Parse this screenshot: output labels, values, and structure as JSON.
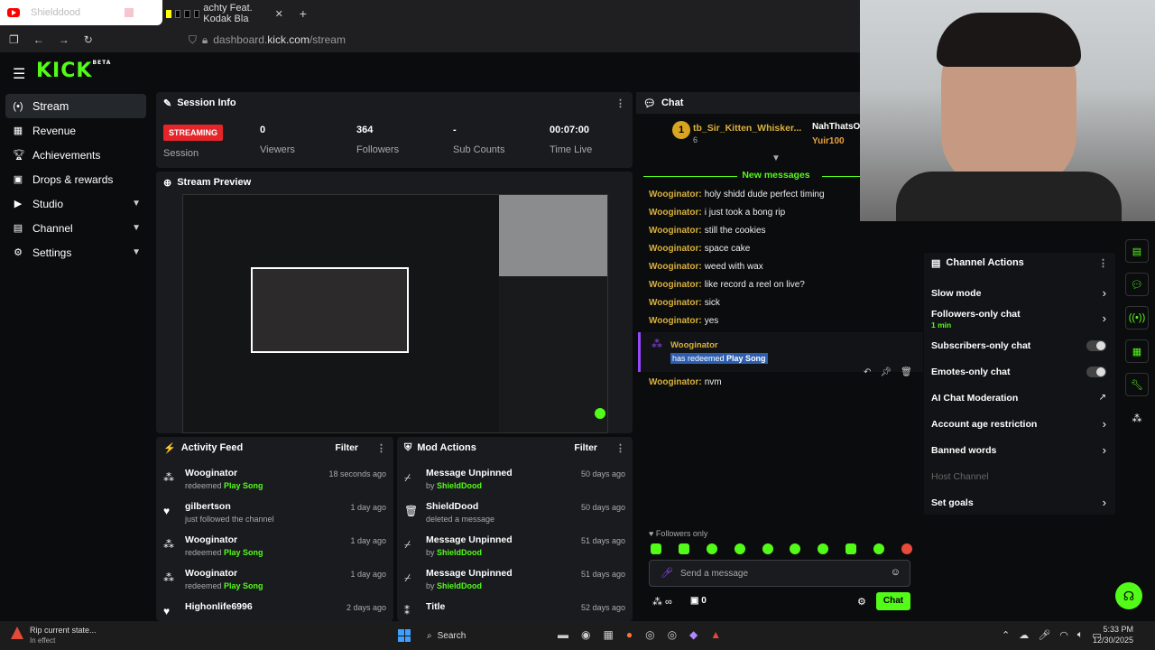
{
  "browser": {
    "tab1_title": "Shielddood",
    "tab2_title": "achty Feat. Kodak Bla",
    "url_prefix": "dashboard.",
    "url_domain": "kick.com",
    "url_path": "/stream"
  },
  "app": {
    "logo": "KICK",
    "logo_badge": "BETA"
  },
  "sidebar": {
    "items": [
      {
        "label": "Stream",
        "icon": "stream-icon"
      },
      {
        "label": "Revenue",
        "icon": "revenue-icon"
      },
      {
        "label": "Achievements",
        "icon": "trophy-icon"
      },
      {
        "label": "Drops & rewards",
        "icon": "gift-icon"
      },
      {
        "label": "Studio",
        "icon": "video-icon"
      },
      {
        "label": "Channel",
        "icon": "channel-icon"
      },
      {
        "label": "Settings",
        "icon": "gear-icon"
      }
    ]
  },
  "session": {
    "title": "Session Info",
    "status": "STREAMING",
    "status_label": "Session",
    "viewers": "0",
    "viewers_label": "Viewers",
    "followers": "364",
    "followers_label": "Followers",
    "subs": "-",
    "subs_label": "Sub Counts",
    "time": "00:07:00",
    "time_label": "Time Live"
  },
  "preview": {
    "title": "Stream Preview"
  },
  "activity": {
    "title": "Activity Feed",
    "filter": "Filter",
    "rows": [
      {
        "name": "Wooginator",
        "pre": "redeemed ",
        "hl": "Play Song",
        "time": "18 seconds ago"
      },
      {
        "name": "gilbertson",
        "pre": "just followed the channel",
        "hl": "",
        "time": "1 day ago"
      },
      {
        "name": "Wooginator",
        "pre": "redeemed ",
        "hl": "Play Song",
        "time": "1 day ago"
      },
      {
        "name": "Wooginator",
        "pre": "redeemed ",
        "hl": "Play Song",
        "time": "1 day ago"
      },
      {
        "name": "Highonlife6996",
        "pre": "",
        "hl": "",
        "time": "2 days ago"
      }
    ]
  },
  "mod": {
    "title": "Mod Actions",
    "filter": "Filter",
    "rows": [
      {
        "name": "Message Unpinned",
        "pre": "by ",
        "hl": "ShieldDood",
        "time": "50 days ago"
      },
      {
        "name": "ShieldDood",
        "pre": "deleted a message",
        "hl": "",
        "time": "50 days ago"
      },
      {
        "name": "Message Unpinned",
        "pre": "by ",
        "hl": "ShieldDood",
        "time": "51 days ago"
      },
      {
        "name": "Message Unpinned",
        "pre": "by ",
        "hl": "ShieldDood",
        "time": "51 days ago"
      },
      {
        "name": "Title",
        "pre": "",
        "hl": "",
        "time": "52 days ago"
      }
    ]
  },
  "chat": {
    "title": "Chat",
    "gifter1": "tb_Sir_Kitten_Whisker...",
    "gifter1_count": "6",
    "gifter2": "NahThatsOk",
    "gifter3": "Yuir100",
    "new_messages": "New messages",
    "messages": [
      {
        "user": "Wooginator:",
        "text": "holy shidd dude perfect timing"
      },
      {
        "user": "Wooginator:",
        "text": "i just took a bong rip"
      },
      {
        "user": "Wooginator:",
        "text": "still the cookies"
      },
      {
        "user": "Wooginator:",
        "text": "space cake"
      },
      {
        "user": "Wooginator:",
        "text": "weed with wax"
      },
      {
        "user": "Wooginator:",
        "text": "like record a reel on live?"
      },
      {
        "user": "Wooginator:",
        "text": "sick"
      },
      {
        "user": "Wooginator:",
        "text": "yes"
      }
    ],
    "redeem_user": "Wooginator",
    "redeem_text": "has redeemed ",
    "redeem_item": "Play Song",
    "last_user": "Wooginator:",
    "last_text": "nvm",
    "followers_only": "Followers only",
    "placeholder": "Send a message",
    "count": "0",
    "send": "Chat"
  },
  "channel_actions": {
    "title": "Channel Actions",
    "items": [
      {
        "label": "Slow mode",
        "kind": "chevron"
      },
      {
        "label": "Followers-only chat",
        "sub": "1 min",
        "kind": "chevron"
      },
      {
        "label": "Subscribers-only chat",
        "kind": "toggle"
      },
      {
        "label": "Emotes-only chat",
        "kind": "toggle"
      },
      {
        "label": "AI Chat Moderation",
        "kind": "external"
      },
      {
        "label": "Account age restriction",
        "kind": "chevron"
      },
      {
        "label": "Banned words",
        "kind": "chevron"
      },
      {
        "label": "Host Channel",
        "kind": "disabled"
      },
      {
        "label": "Set goals",
        "kind": "chevron"
      }
    ]
  },
  "notification": {
    "title": "Rip current state...",
    "sub": "In effect"
  },
  "taskbar": {
    "search": "Search",
    "time": "5:33 PM",
    "date": "12/30/2025"
  },
  "colors": {
    "accent": "#53fc18",
    "streaming": "#e5252a",
    "chat_user": "#d9b13d"
  }
}
